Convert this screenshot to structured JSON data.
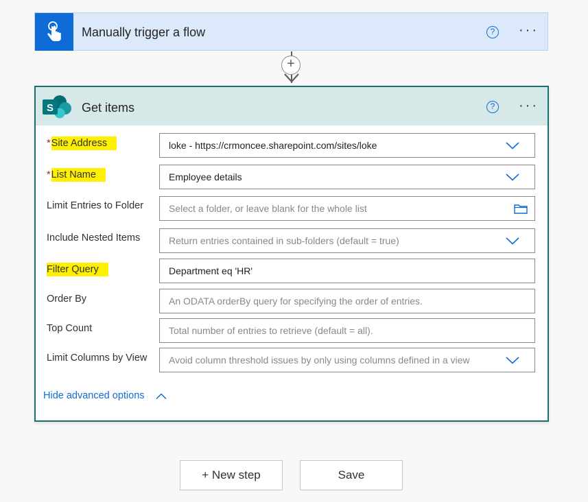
{
  "trigger": {
    "title": "Manually trigger a flow",
    "help_glyph": "?",
    "more_glyph": "···",
    "icon": "hand-touch-icon"
  },
  "connector": {
    "plus_glyph": "+"
  },
  "action": {
    "title": "Get items",
    "help_glyph": "?",
    "more_glyph": "···",
    "icon": "sharepoint-icon",
    "logo_letter": "S",
    "fields": [
      {
        "label": "Site Address",
        "required": true,
        "value": "loke - https://crmoncee.sharepoint.com/sites/loke",
        "placeholder": "",
        "control": "dropdown"
      },
      {
        "label": "List Name",
        "required": true,
        "value": "Employee details",
        "placeholder": "",
        "control": "dropdown"
      },
      {
        "label": "Limit Entries to Folder",
        "required": false,
        "value": "",
        "placeholder": "Select a folder, or leave blank for the whole list",
        "control": "folder-picker"
      },
      {
        "label": "Include Nested Items",
        "required": false,
        "value": "",
        "placeholder": "Return entries contained in sub-folders (default = true)",
        "control": "dropdown"
      },
      {
        "label": "Filter Query",
        "required": false,
        "value": "Department eq 'HR'",
        "placeholder": "",
        "control": "text"
      },
      {
        "label": "Order By",
        "required": false,
        "value": "",
        "placeholder": "An ODATA orderBy query for specifying the order of entries.",
        "control": "text"
      },
      {
        "label": "Top Count",
        "required": false,
        "value": "",
        "placeholder": "Total number of entries to retrieve (default = all).",
        "control": "text"
      },
      {
        "label": "Limit Columns by View",
        "required": false,
        "value": "",
        "placeholder": "Avoid column threshold issues by only using columns defined in a view",
        "control": "dropdown"
      }
    ],
    "required_mark": "*",
    "advanced_toggle": "Hide advanced options"
  },
  "footer": {
    "new_step": "+ New step",
    "save": "Save"
  },
  "colors": {
    "accent": "#0f6cd6",
    "trigger_bg": "#dbe9fb",
    "action_header_bg": "#d7e8e8",
    "action_border": "#1b6f6a",
    "highlight": "#fff100",
    "required": "#a4262c"
  }
}
